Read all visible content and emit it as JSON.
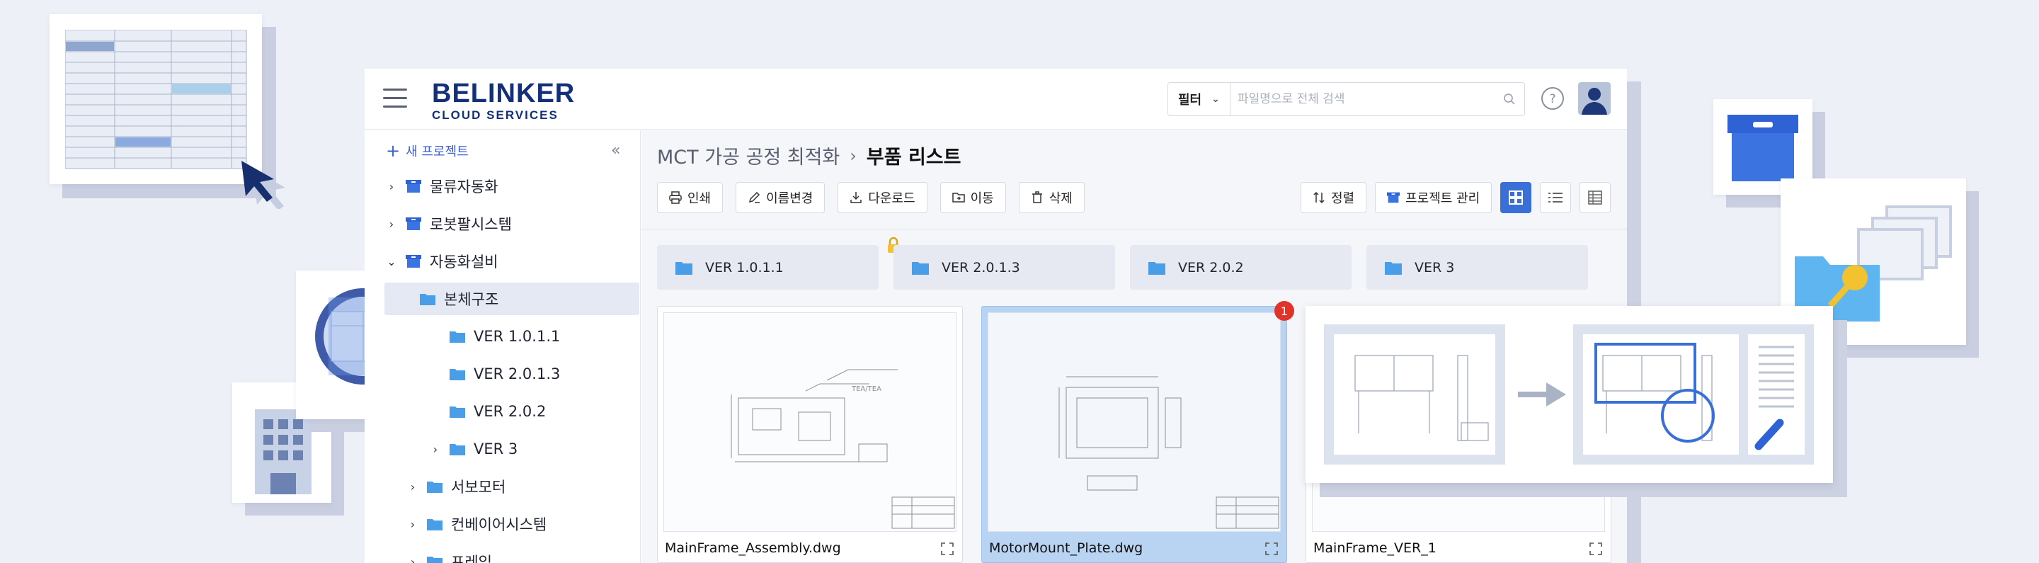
{
  "app": {
    "logo_main": "BELINKER",
    "logo_sub": "CLOUD SERVICES"
  },
  "search": {
    "filter_label": "필터",
    "placeholder": "파일명으로 전체 검색"
  },
  "sidebar": {
    "new_project": "새 프로젝트",
    "items": [
      {
        "label": "물류자동화"
      },
      {
        "label": "로봇팔시스템"
      },
      {
        "label": "자동화설비"
      },
      {
        "label": "본체구조"
      },
      {
        "label": "VER 1.0.1.1"
      },
      {
        "label": "VER 2.0.1.3"
      },
      {
        "label": "VER 2.0.2"
      },
      {
        "label": "VER 3"
      },
      {
        "label": "서보모터"
      },
      {
        "label": "컨베이어시스템"
      },
      {
        "label": "프레임"
      }
    ]
  },
  "breadcrumb": {
    "parent": "MCT 가공 공정 최적화",
    "separator": "›",
    "current": "부품 리스트"
  },
  "toolbar": {
    "print": "인쇄",
    "rename": "이름변경",
    "download": "다운로드",
    "move": "이동",
    "delete": "삭제",
    "sort": "정렬",
    "manage": "프로젝트 관리"
  },
  "folders": [
    {
      "label": "VER 1.0.1.1"
    },
    {
      "label": "VER 2.0.1.3"
    },
    {
      "label": "VER 2.0.2"
    },
    {
      "label": "VER 3"
    }
  ],
  "files": [
    {
      "name": "MainFrame_Assembly.dwg"
    },
    {
      "name": "MotorMount_Plate.dwg"
    },
    {
      "name": "MainFrame_VER_1"
    }
  ],
  "notification_count": "1",
  "colors": {
    "brand": "#14307a",
    "accent": "#3b6fd8",
    "folder": "#4a9ee8",
    "badge": "#e0332a"
  }
}
